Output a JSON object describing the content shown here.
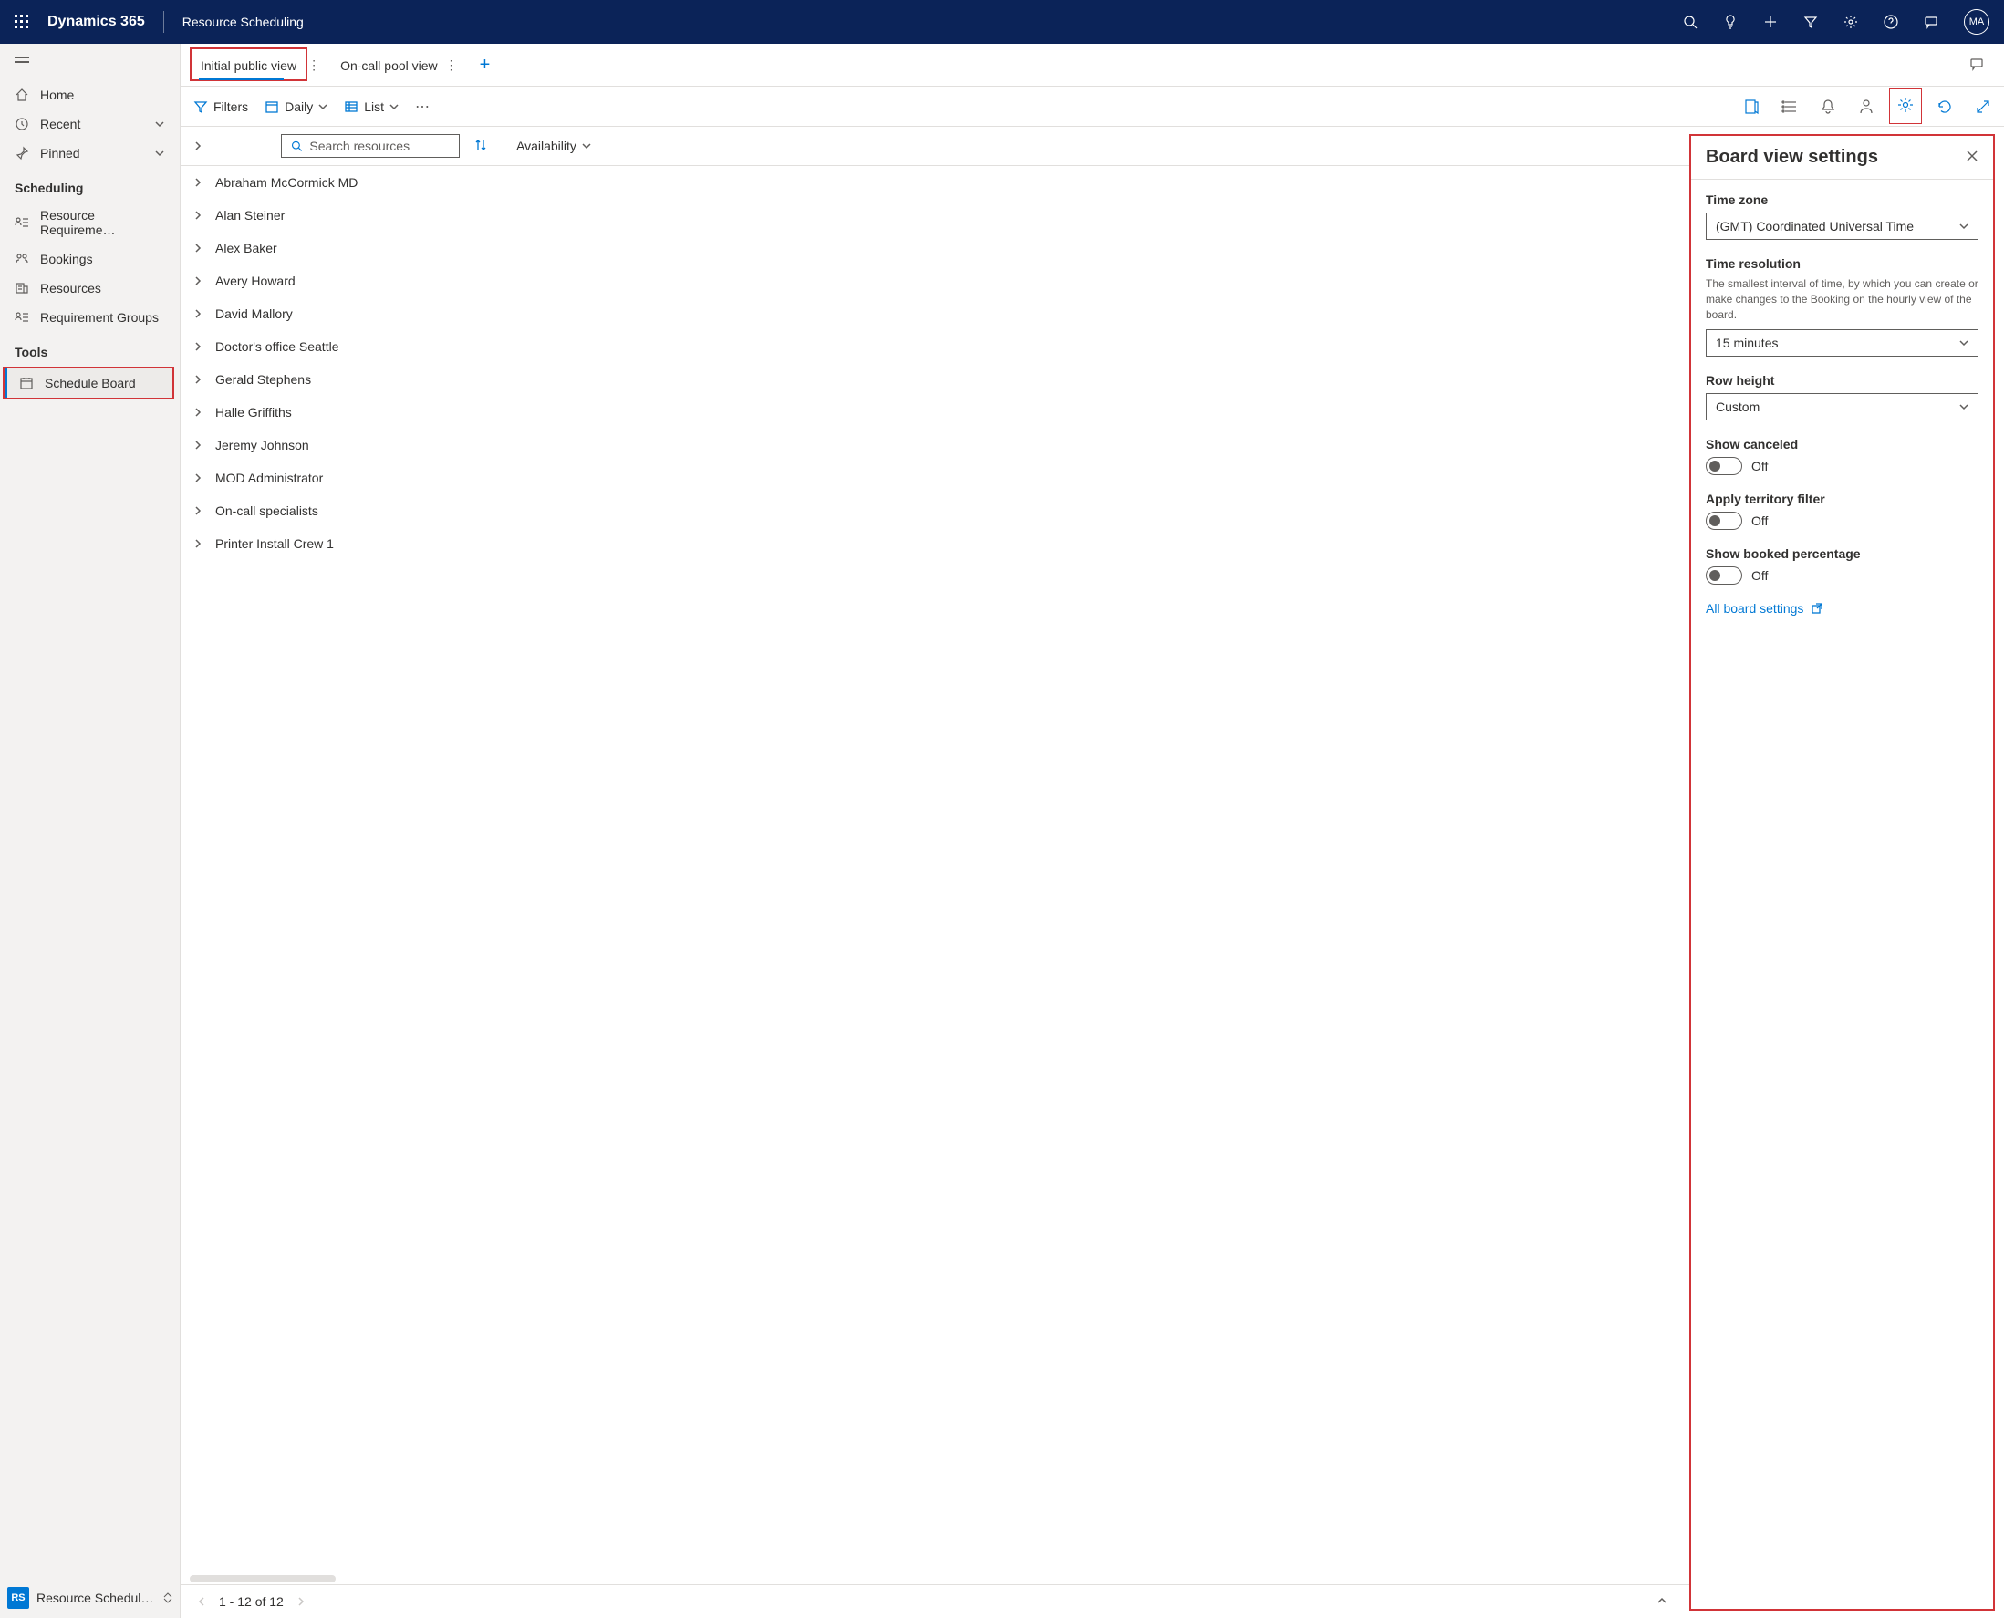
{
  "header": {
    "brand": "Dynamics 365",
    "module": "Resource Scheduling",
    "avatar": "MA"
  },
  "sidebar": {
    "home": "Home",
    "recent": "Recent",
    "pinned": "Pinned",
    "section_scheduling": "Scheduling",
    "resource_requirements": "Resource Requireme…",
    "bookings": "Bookings",
    "resources": "Resources",
    "requirement_groups": "Requirement Groups",
    "section_tools": "Tools",
    "schedule_board": "Schedule Board",
    "footer_badge": "RS",
    "footer_text": "Resource Schedul…"
  },
  "tabs": {
    "initial": "Initial public view",
    "oncall": "On-call pool view"
  },
  "toolbar": {
    "filters": "Filters",
    "daily": "Daily",
    "list": "List"
  },
  "search": {
    "placeholder": "Search resources",
    "availability": "Availability"
  },
  "resources": [
    "Abraham McCormick MD",
    "Alan Steiner",
    "Alex Baker",
    "Avery Howard",
    "David Mallory",
    "Doctor's office Seattle",
    "Gerald Stephens",
    "Halle Griffiths",
    "Jeremy Johnson",
    "MOD Administrator",
    "On-call specialists",
    "Printer Install Crew 1"
  ],
  "pagination": "1 - 12 of 12",
  "settings": {
    "title": "Board view settings",
    "timezone_label": "Time zone",
    "timezone_value": "(GMT) Coordinated Universal Time",
    "timeres_label": "Time resolution",
    "timeres_help": "The smallest interval of time, by which you can create or make changes to the Booking on the hourly view of the board.",
    "timeres_value": "15 minutes",
    "rowheight_label": "Row height",
    "rowheight_value": "Custom",
    "show_canceled_label": "Show canceled",
    "show_canceled_state": "Off",
    "territory_label": "Apply territory filter",
    "territory_state": "Off",
    "booked_pct_label": "Show booked percentage",
    "booked_pct_state": "Off",
    "all_settings": "All board settings"
  }
}
